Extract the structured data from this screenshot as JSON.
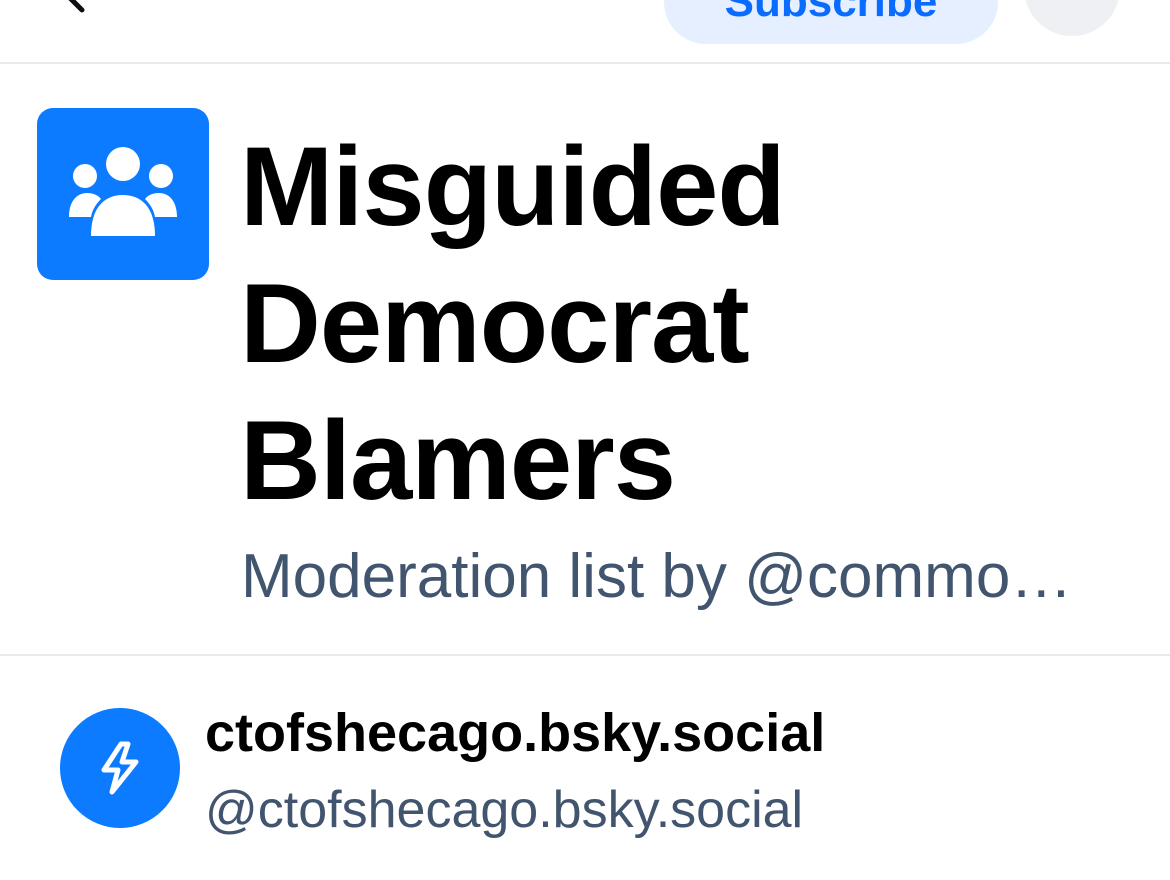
{
  "header": {
    "back_icon": "chevron-left-icon",
    "subscribe_label": "Subscribe",
    "more_icon": "ellipsis-icon"
  },
  "list": {
    "avatar_icon": "users-group-icon",
    "title": "Misguided Democrat Blamers",
    "subtitle": "Moderation list by @commo…"
  },
  "members": [
    {
      "avatar_icon": "lightning-bolt-icon",
      "display_name": "ctofshecago.bsky.social",
      "handle": "@ctofshecago.bsky.social"
    }
  ],
  "colors": {
    "accent": "#0c7bff",
    "subscribe_bg": "#e5efff",
    "subscribe_text": "#0a6cff",
    "muted_text": "#42556e",
    "divider": "#e6e9ee"
  }
}
